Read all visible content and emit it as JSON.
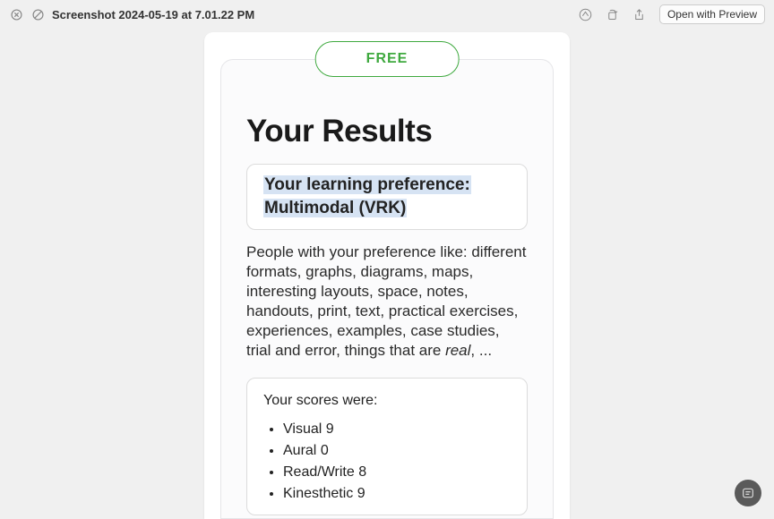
{
  "titlebar": {
    "title": "Screenshot 2024-05-19 at 7.01.22 PM",
    "open_button": "Open with Preview"
  },
  "badge": {
    "label": "FREE"
  },
  "results": {
    "heading": "Your Results",
    "preference_label": "Your learning preference:",
    "preference_value": "Multimodal (VRK)",
    "description_prefix": "People with your preference like: different formats, graphs, diagrams, maps, interesting layouts, space, notes, handouts, print, text, practical exercises, experiences, examples, case studies, trial and error, things that are ",
    "description_italic": "real",
    "description_suffix": ", ...",
    "scores_title": "Your scores were:",
    "scores": [
      {
        "label": "Visual",
        "value": 9
      },
      {
        "label": "Aural",
        "value": 0
      },
      {
        "label": "Read/Write",
        "value": 8
      },
      {
        "label": "Kinesthetic",
        "value": 9
      }
    ]
  }
}
